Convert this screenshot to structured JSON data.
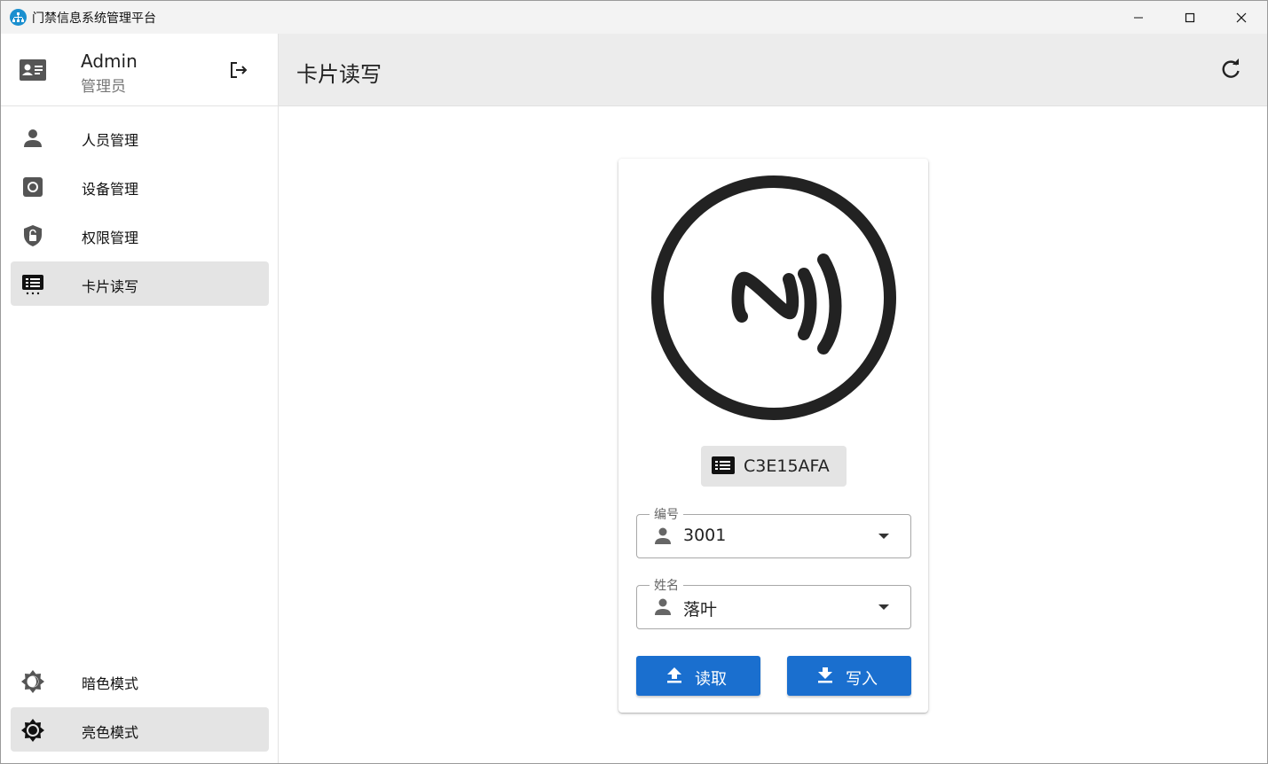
{
  "window": {
    "title": "门禁信息系统管理平台"
  },
  "user": {
    "name": "Admin",
    "role": "管理员"
  },
  "nav": {
    "items": [
      {
        "label": "人员管理",
        "icon": "person-icon"
      },
      {
        "label": "设备管理",
        "icon": "device-icon"
      },
      {
        "label": "权限管理",
        "icon": "shield-lock-icon"
      },
      {
        "label": "卡片读写",
        "icon": "card-reader-icon",
        "active": true
      }
    ],
    "themes": [
      {
        "label": "暗色模式",
        "icon": "dark-mode-icon"
      },
      {
        "label": "亮色模式",
        "icon": "light-mode-icon",
        "active": true
      }
    ]
  },
  "page": {
    "title": "卡片读写"
  },
  "card": {
    "card_id": "C3E15AFA",
    "fields": [
      {
        "label": "编号",
        "value": "3001"
      },
      {
        "label": "姓名",
        "value": "落叶"
      }
    ],
    "buttons": {
      "read": "读取",
      "write": "写入"
    }
  },
  "colors": {
    "accent": "#1a6fcf",
    "sidebar_active": "#e4e4e4",
    "header_bg": "#ececec",
    "app_icon": "#1a8fcf"
  }
}
